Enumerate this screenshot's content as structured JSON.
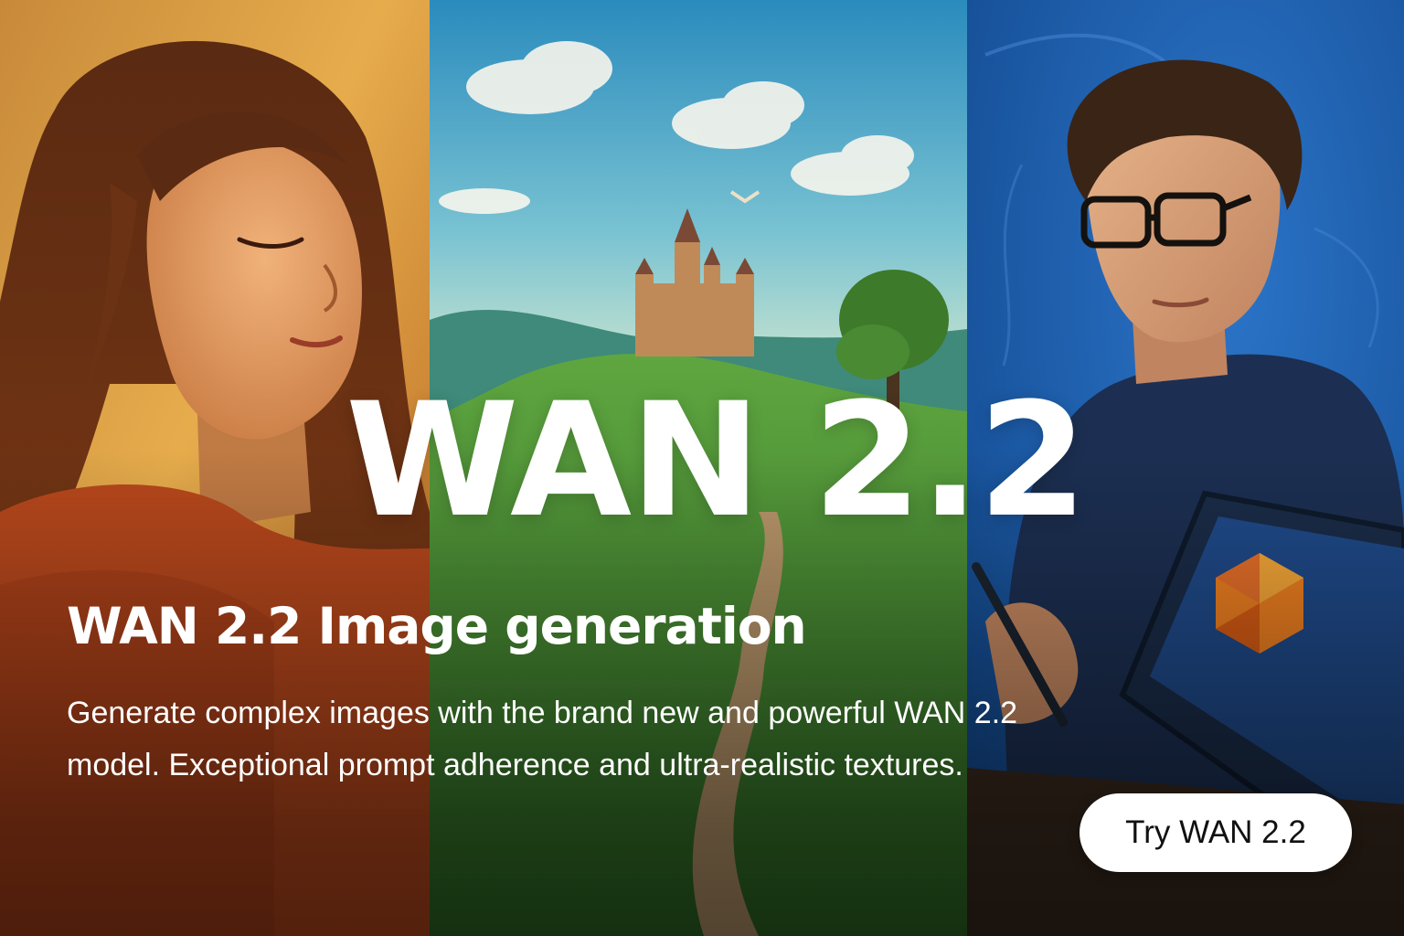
{
  "hero": {
    "title": "WAN 2.2",
    "headline": "WAN 2.2 Image generation",
    "description": "Generate complex images with the brand new and powerful WAN 2.2 model. Exceptional prompt adherence and ultra-realistic textures.",
    "cta_label": "Try WAN 2.2"
  },
  "panels": [
    {
      "subject": "portrait-woman-eyes-closed",
      "tone": "#e0a040"
    },
    {
      "subject": "castle-landscape",
      "tone": "#3aa0c8"
    },
    {
      "subject": "man-with-glasses-using-tablet",
      "tone": "#1f5fb0"
    }
  ],
  "colors": {
    "text": "#ffffff",
    "button_bg": "#ffffff",
    "button_text": "#111111",
    "tablet_logo": "#f08020"
  }
}
